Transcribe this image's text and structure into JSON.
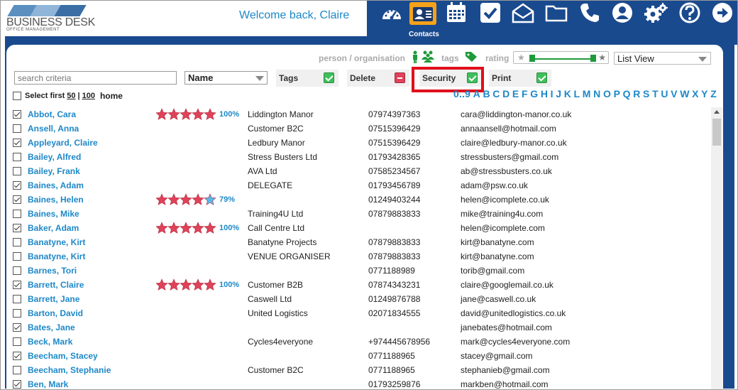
{
  "app": {
    "logo_name": "BUSINESS DESK",
    "logo_sub": "OFFICE MANAGEMENT",
    "welcome": "Welcome back, Claire"
  },
  "nav": {
    "active_label": "Contacts",
    "items": [
      {
        "name": "dashboard-icon"
      },
      {
        "name": "contacts-icon",
        "active": true
      },
      {
        "name": "calendar-icon"
      },
      {
        "name": "tasks-icon"
      },
      {
        "name": "mail-icon"
      },
      {
        "name": "folder-icon"
      },
      {
        "name": "phone-icon"
      },
      {
        "name": "user-icon"
      },
      {
        "name": "settings-icon"
      },
      {
        "name": "help-icon"
      },
      {
        "name": "logout-icon"
      }
    ],
    "accent": "#f5a21a",
    "band_color": "#1a4a8e"
  },
  "filters": {
    "person_org_label": "person / organisation",
    "tags_label": "tags",
    "rating_label": "rating",
    "view_select": "List View",
    "search_placeholder": "search criteria",
    "field_select": "Name",
    "options": {
      "tags": "Tags",
      "delete": "Delete",
      "security": "Security",
      "print": "Print"
    },
    "select_first": "Select first",
    "select_50": "50",
    "select_sep": "|",
    "select_100": "100",
    "select_home": "home",
    "alphabet": [
      "0..9",
      "A",
      "B",
      "C",
      "D",
      "E",
      "F",
      "G",
      "H",
      "I",
      "J",
      "K",
      "L",
      "M",
      "N",
      "O",
      "P",
      "Q",
      "R",
      "S",
      "T",
      "U",
      "V",
      "W",
      "X",
      "Y",
      "Z"
    ]
  },
  "contacts": [
    {
      "checked": true,
      "name": "Abbot, Cara",
      "stars": 5,
      "pct": "100%",
      "org": "Liddington Manor",
      "phone": "07974397363",
      "email": "cara@liddington-manor.co.uk"
    },
    {
      "checked": false,
      "name": "Ansell, Anna",
      "stars": 0,
      "pct": "",
      "org": "Customer B2C",
      "phone": "07515396429",
      "email": "annaansell@hotmail.com"
    },
    {
      "checked": true,
      "name": "Appleyard, Claire",
      "stars": 0,
      "pct": "",
      "org": "Ledbury Manor",
      "phone": "07515396429",
      "email": "claire@ledbury-manor.co.uk"
    },
    {
      "checked": false,
      "name": "Bailey, Alfred",
      "stars": 0,
      "pct": "",
      "org": "Stress Busters Ltd",
      "phone": "01793428365",
      "email": "stressbusters@gmail.com"
    },
    {
      "checked": false,
      "name": "Bailey, Frank",
      "stars": 0,
      "pct": "",
      "org": "AVA Ltd",
      "phone": "07585234567",
      "email": "ab@stressbusters.co.uk"
    },
    {
      "checked": true,
      "name": "Baines, Adam",
      "stars": 0,
      "pct": "",
      "org": "DELEGATE",
      "phone": "01793456789",
      "email": "adam@psw.co.uk"
    },
    {
      "checked": true,
      "name": "Baines, Helen",
      "stars": 4,
      "pct": "79%",
      "org": "",
      "phone": "01249403244",
      "email": "helen@icomplete.co.uk"
    },
    {
      "checked": false,
      "name": "Baines, Mike",
      "stars": 0,
      "pct": "",
      "org": "Training4U Ltd",
      "phone": "07879883833",
      "email": "mike@training4u.com"
    },
    {
      "checked": true,
      "name": "Baker, Adam",
      "stars": 5,
      "pct": "100%",
      "org": "Call Centre Ltd",
      "phone": "",
      "email": "helen@icomplete.com"
    },
    {
      "checked": false,
      "name": "Banatyne, Kirt",
      "stars": 0,
      "pct": "",
      "org": "Banatyne Projects",
      "phone": "07879883833",
      "email": "kirt@banatyne.com"
    },
    {
      "checked": false,
      "name": "Banatyne, Kirt",
      "stars": 0,
      "pct": "",
      "org": "VENUE ORGANISER",
      "phone": "07879883833",
      "email": "kirt@banatyne.com"
    },
    {
      "checked": false,
      "name": "Barnes, Tori",
      "stars": 0,
      "pct": "",
      "org": "",
      "phone": "0771188989",
      "email": "torib@gmail.com"
    },
    {
      "checked": true,
      "name": "Barrett, Claire",
      "stars": 5,
      "pct": "100%",
      "org": "Customer B2B",
      "phone": "07874343231",
      "email": "claire@googlemail.co.uk"
    },
    {
      "checked": false,
      "name": "Barrett, Jane",
      "stars": 0,
      "pct": "",
      "org": "Caswell Ltd",
      "phone": "01249876788",
      "email": "jane@caswell.co.uk"
    },
    {
      "checked": false,
      "name": "Barton, David",
      "stars": 0,
      "pct": "",
      "org": "United Logistics",
      "phone": "02071834555",
      "email": "david@unitedlogistics.co.uk"
    },
    {
      "checked": true,
      "name": "Bates, Jane",
      "stars": 0,
      "pct": "",
      "org": "",
      "phone": "",
      "email": "janebates@hotmail.com"
    },
    {
      "checked": false,
      "name": "Beck, Mark",
      "stars": 0,
      "pct": "",
      "org": "Cycles4everyone",
      "phone": "+974445678956",
      "email": "mark@cycles4everyone.com"
    },
    {
      "checked": true,
      "name": "Beecham, Stacey",
      "stars": 0,
      "pct": "",
      "org": "",
      "phone": "0771188965",
      "email": "stacey@gmail.com"
    },
    {
      "checked": false,
      "name": "Beecham, Stephanie",
      "stars": 0,
      "pct": "",
      "org": "Customer B2C",
      "phone": "0771188965",
      "email": "stephanieb@gmail.com"
    },
    {
      "checked": true,
      "name": "Ben, Mark",
      "stars": 0,
      "pct": "",
      "org": "",
      "phone": "01793259876",
      "email": "markben@hotmail.com"
    }
  ]
}
